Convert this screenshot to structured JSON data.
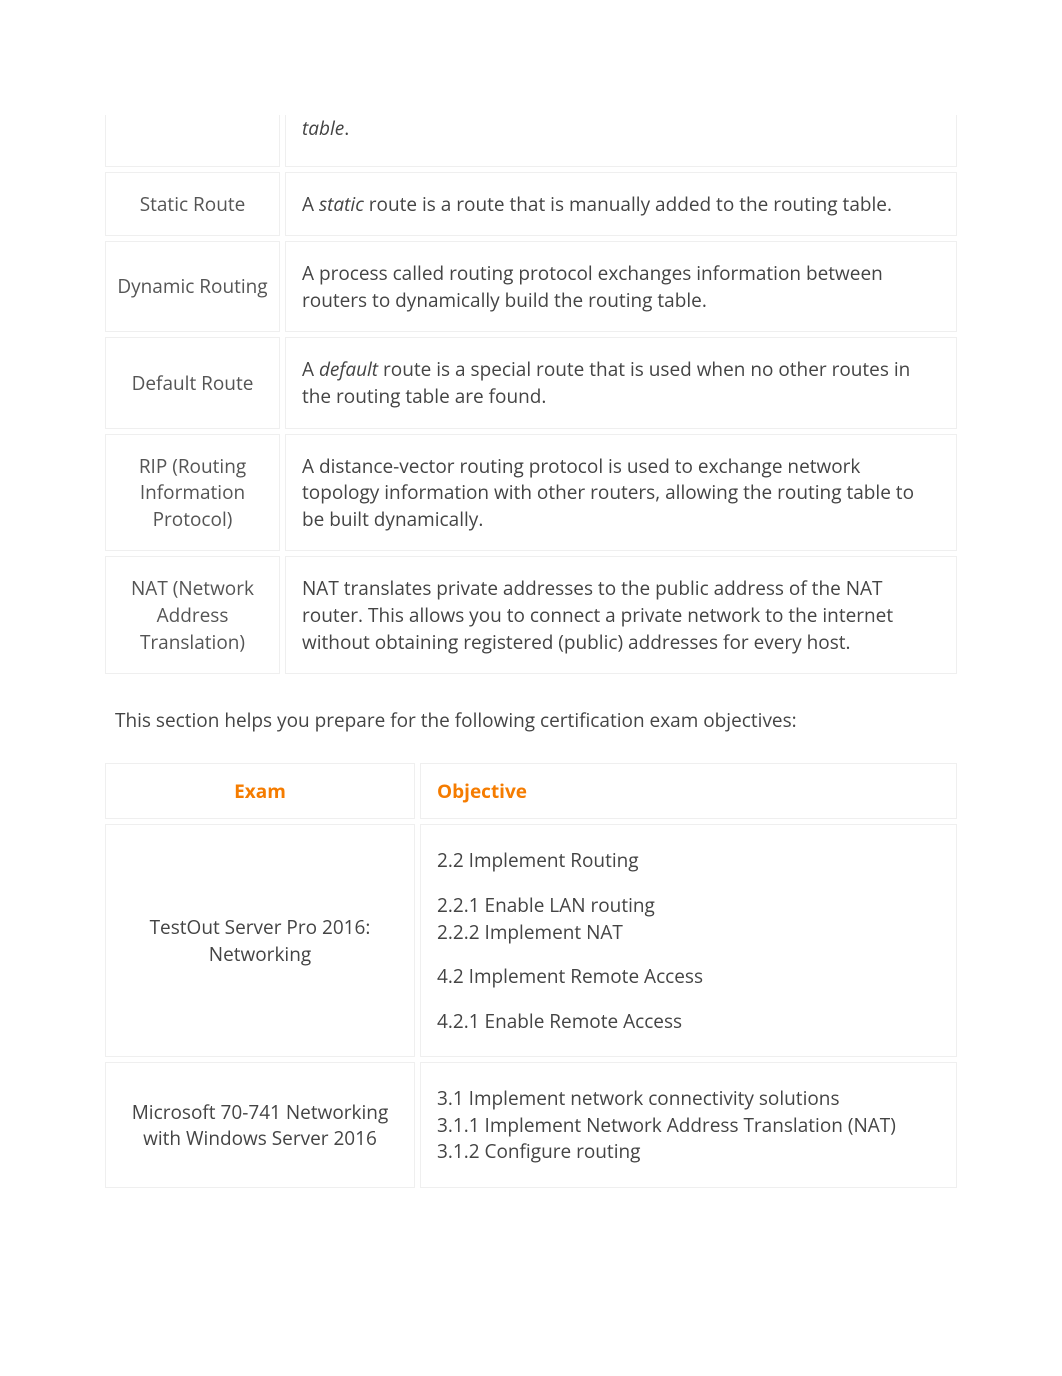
{
  "terms_table": {
    "rows": [
      {
        "term": "",
        "definition_italic_word": "table",
        "definition_rest": "."
      },
      {
        "term": "Static Route",
        "definition_prefix": "A ",
        "definition_italic_word": "static",
        "definition_rest": " route is a route that is manually added to the routing table."
      },
      {
        "term": "Dynamic Routing",
        "definition_prefix": "",
        "definition_italic_word": "",
        "definition_rest": "A process called routing protocol exchanges information between routers to dynamically build the routing table."
      },
      {
        "term": "Default Route",
        "definition_prefix": "A ",
        "definition_italic_word": "default",
        "definition_rest": " route is a special route that is used when no other routes in the routing table are found."
      },
      {
        "term": "RIP (Routing Information Protocol)",
        "definition_prefix": "",
        "definition_italic_word": "",
        "definition_rest": "A distance-vector routing protocol is used to exchange network topology information with other routers, allowing the routing table to be built dynamically."
      },
      {
        "term": "NAT (Network Address Translation)",
        "definition_prefix": "",
        "definition_italic_word": "",
        "definition_rest": "NAT translates private addresses to the public address of the NAT router. This allows you to connect a private network to the internet without obtaining registered (public) addresses for every host."
      }
    ]
  },
  "intro_text": "This section helps you prepare for the following certification exam objectives:",
  "exam_table": {
    "headers": {
      "exam": "Exam",
      "objective": "Objective"
    },
    "rows": [
      {
        "exam": "TestOut Server Pro 2016: Networking",
        "objectives": {
          "block1_line1": "2.2 Implement Routing",
          "block2_line1": "2.2.1 Enable LAN routing",
          "block2_line2": "2.2.2 Implement NAT",
          "block3_line1": "4.2 Implement Remote Access",
          "block4_line1": "4.2.1 Enable Remote Access"
        }
      },
      {
        "exam": "Microsoft 70-741 Networking with Windows Server 2016",
        "objectives": {
          "line1": "3.1 Implement network connectivity solutions",
          "line2": "3.1.1 Implement Network Address Translation (NAT)",
          "line3": "3.1.2 Configure routing"
        }
      }
    ]
  }
}
